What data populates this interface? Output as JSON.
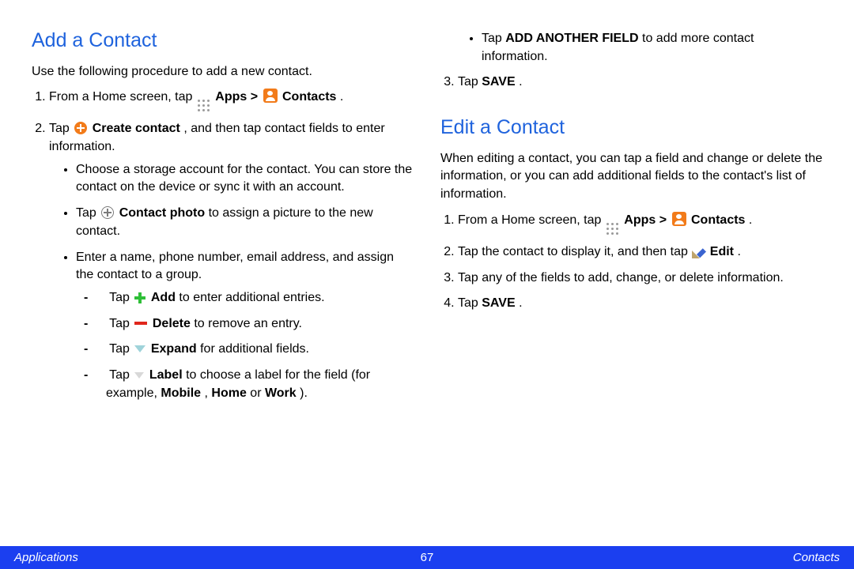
{
  "left": {
    "heading": "Add a Contact",
    "intro": "Use the following procedure to add a new contact.",
    "step1_a": "From a Home screen, tap ",
    "apps_label": "Apps",
    "gt": " > ",
    "contacts_label": "Contacts",
    "period": ".",
    "step2_a": "Tap ",
    "create_contact": "Create contact",
    "step2_b": ", and then tap contact fields to enter information.",
    "bul1": "Choose a storage account for the contact. You can store the contact on the device or sync it with an account.",
    "bul2_a": "Tap ",
    "contact_photo": "Contact photo",
    "bul2_b": " to assign a picture to the new contact.",
    "bul3": "Enter a name, phone number, email address, and assign the contact to a group.",
    "d1_a": "Tap ",
    "add_label": "Add",
    "d1_b": " to enter additional entries.",
    "d2_a": "Tap ",
    "delete_label": "Delete",
    "d2_b": " to remove an entry.",
    "d3_a": "Tap ",
    "expand_label": "Expand",
    "d3_b": " for additional fields.",
    "d4_a": "Tap ",
    "label_label": "Label",
    "d4_b": " to choose a label for the field (for example, ",
    "mobile": "Mobile",
    "comma": ", ",
    "home": "Home",
    "or": " or ",
    "work": "Work",
    "close_paren": ")."
  },
  "right": {
    "cont_bullet_a": "Tap ",
    "add_another": "ADD ANOTHER FIELD",
    "cont_bullet_b": " to add more contact information.",
    "step3_a": "Tap ",
    "save": "SAVE",
    "heading": "Edit a Contact",
    "intro": "When editing a contact, you can tap a field and change or delete the information, or you can add additional fields to the contact's list of information.",
    "e1_a": "From a Home screen, tap ",
    "apps_label": "Apps",
    "gt": " > ",
    "contacts_label": "Contacts",
    "period": ".",
    "e2_a": "Tap the contact to display it, and then tap ",
    "edit_label": "Edit",
    "e3": "Tap any of the fields to add, change, or delete information.",
    "e4_a": "Tap ",
    "save2": "SAVE"
  },
  "footer": {
    "left": "Applications",
    "center": "67",
    "right": "Contacts"
  }
}
